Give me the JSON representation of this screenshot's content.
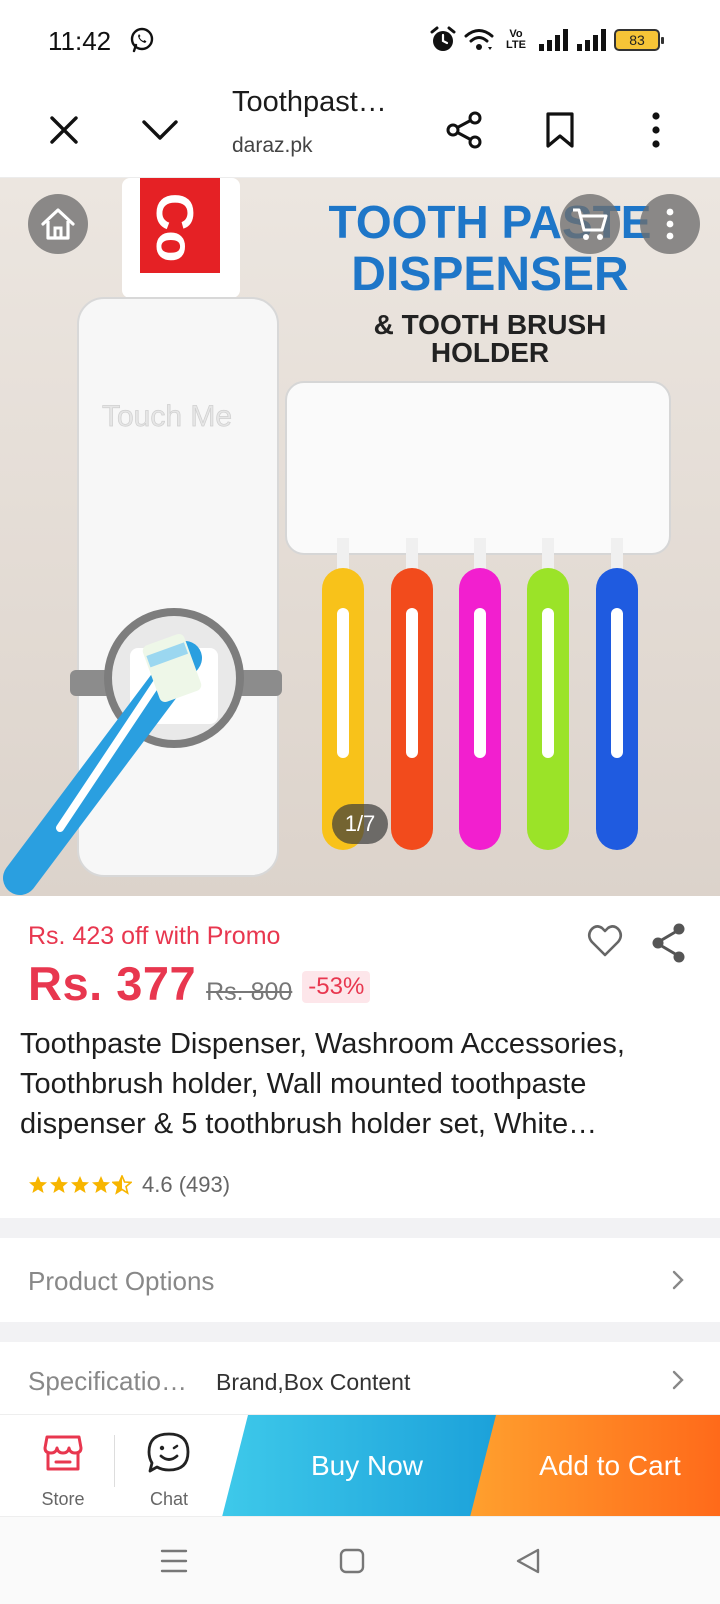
{
  "status_bar": {
    "time": "11:42",
    "volte_label": "VoLTE",
    "battery": "83",
    "icons": [
      "whatsapp-icon",
      "alarm-icon",
      "wifi-icon",
      "signal-icon",
      "signal-icon",
      "battery-icon"
    ]
  },
  "browser": {
    "title": "Toothpast…",
    "domain": "daraz.pk",
    "icons": [
      "close-icon",
      "chevron-down-icon",
      "share-icon",
      "bookmark-icon",
      "more-vertical-icon"
    ]
  },
  "hero": {
    "counter": "1/7",
    "icons": [
      "home-icon",
      "cart-icon",
      "more-vertical-icon"
    ],
    "image_text": {
      "line1": "TOOTH PASTE",
      "line2": "DISPENSER",
      "line3": "& TOOTH BRUSH",
      "line4": "HOLDER",
      "tube_brand": "Co",
      "dispenser_label": "Touch Me"
    }
  },
  "product": {
    "promo_text": "Rs. 423 off with Promo",
    "price": "Rs. 377",
    "original_price": "Rs. 800",
    "discount": "-53%",
    "title": "Toothpaste Dispenser, Washroom Accessories, Toothbrush holder, Wall mounted toothpaste dispenser & 5 toothbrush holder set, White…",
    "rating_value": 4.6,
    "rating_text": "4.6 (493)",
    "accent_color": "#e8374f"
  },
  "rows": {
    "options_label": "Product Options",
    "spec_label": "Specificatio…",
    "spec_value": "Brand,Box Content"
  },
  "actions": {
    "store_label": "Store",
    "chat_label": "Chat",
    "buy_now": "Buy Now",
    "add_to_cart": "Add to Cart",
    "buy_color": "#1a9fd9",
    "cart_color": "#ff6a1a"
  },
  "system_nav": {
    "icons": [
      "menu-icon",
      "home-square-icon",
      "back-triangle-icon"
    ]
  }
}
